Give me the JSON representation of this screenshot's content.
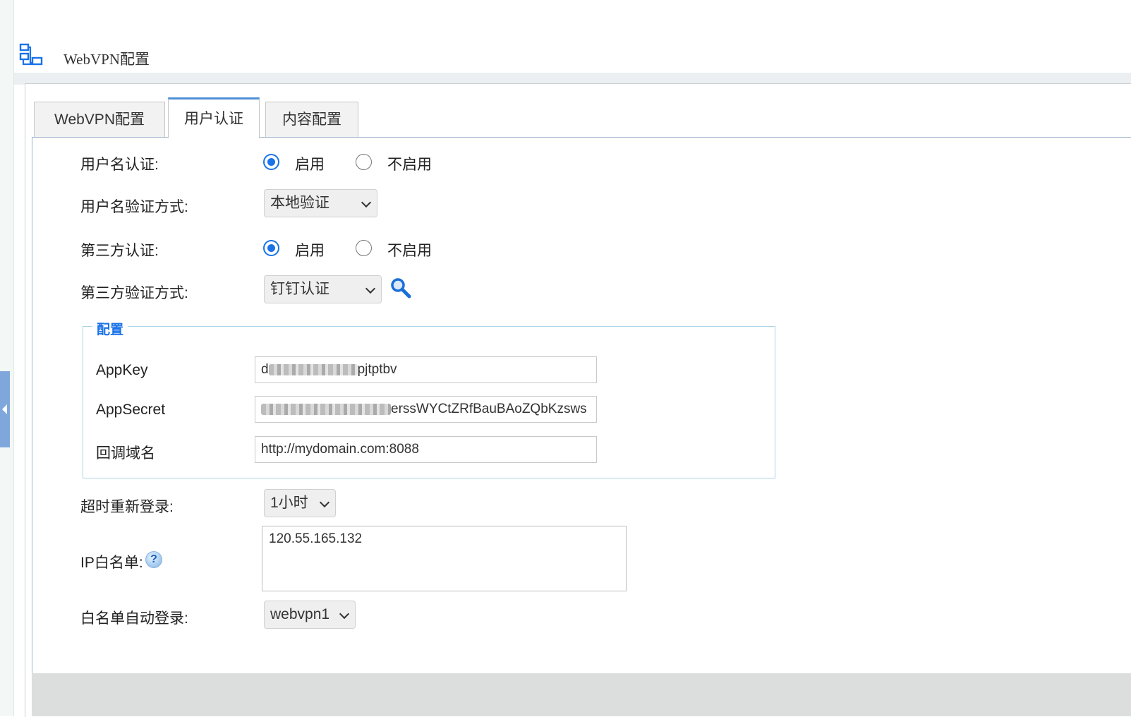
{
  "window": {
    "title": "WebVPN配置",
    "title_icon": "network-icon"
  },
  "tabs": [
    {
      "label": "WebVPN配置",
      "active": false
    },
    {
      "label": "用户认证",
      "active": true
    },
    {
      "label": "内容配置",
      "active": false
    }
  ],
  "form": {
    "username_auth": {
      "label": "用户名认证:",
      "options": [
        "启用",
        "不启用"
      ],
      "selected": "启用"
    },
    "username_method": {
      "label": "用户名验证方式:",
      "value": "本地验证"
    },
    "third_party_auth": {
      "label": "第三方认证:",
      "options": [
        "启用",
        "不启用"
      ],
      "selected": "启用"
    },
    "third_party_method": {
      "label": "第三方验证方式:",
      "value": "钉钉认证",
      "action_icon": "search-icon"
    },
    "config": {
      "legend": "配置",
      "app_key": {
        "label": "AppKey",
        "prefix": "d",
        "suffix": "pjtptbv"
      },
      "app_secret": {
        "label": "AppSecret",
        "suffix": "erssWYCtZRfBauBAoZQbKzsws"
      },
      "callback_domain": {
        "label": "回调域名",
        "value": "http://mydomain.com:8088"
      }
    },
    "timeout_relogin": {
      "label": "超时重新登录:",
      "value": "1小时"
    },
    "ip_whitelist": {
      "label": "IP白名单:",
      "value": "120.55.165.132",
      "help_icon": "help-icon",
      "help_text": "?"
    },
    "whitelist_auto_login": {
      "label": "白名单自动登录:",
      "value": "webvpn1"
    }
  },
  "colors": {
    "accent": "#1a73e8",
    "tab_accent": "#4e8fd6",
    "fieldset_border": "#a9d4e6",
    "bottom_bar": "#dcdedd"
  }
}
